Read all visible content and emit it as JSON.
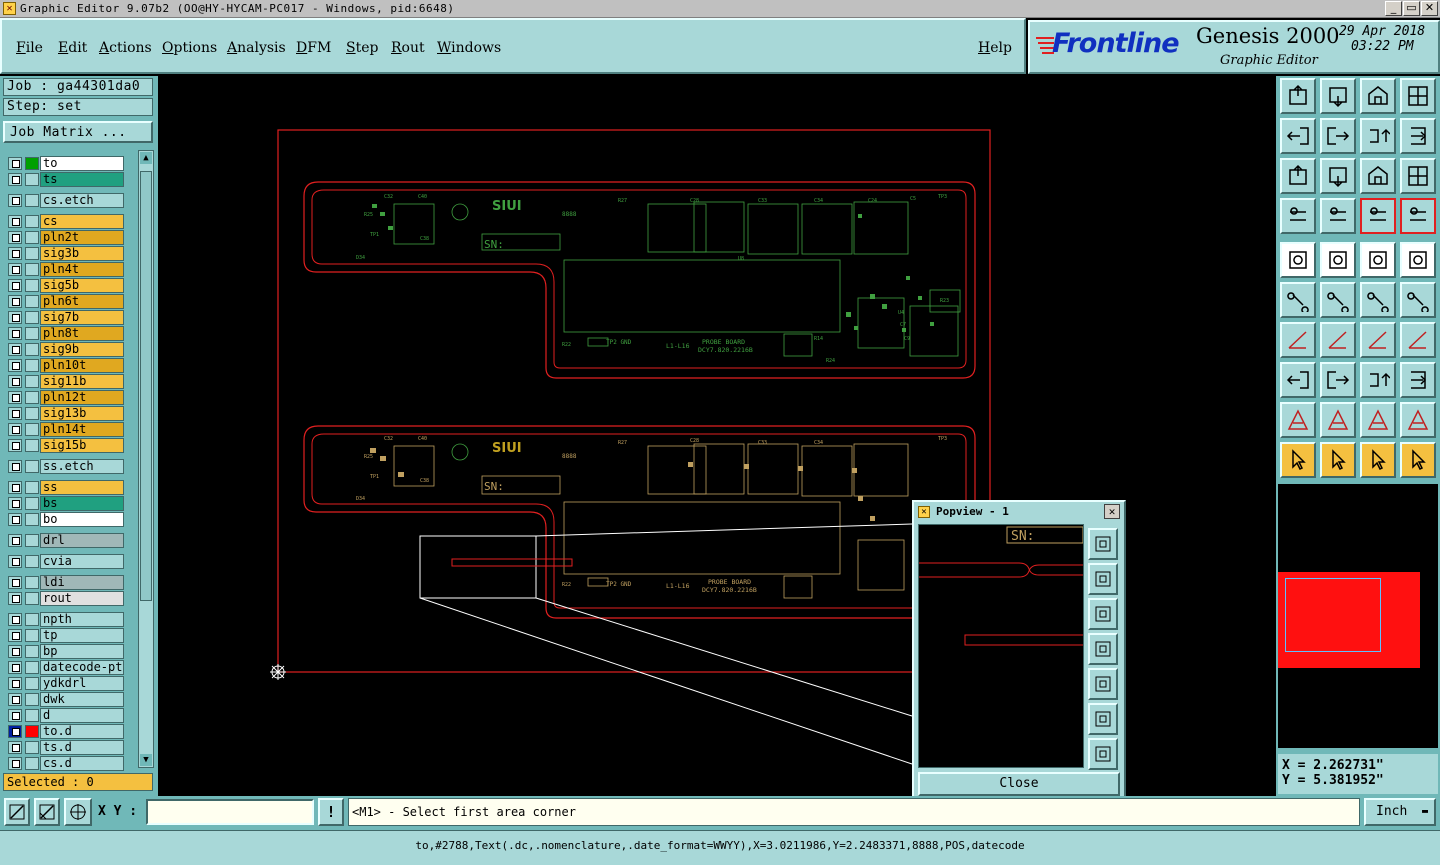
{
  "window": {
    "title": "Graphic Editor 9.07b2 (OO@HY-HYCAM-PC017 - Windows, pid:6648)",
    "buttons": [
      "_",
      "▭",
      "✕"
    ]
  },
  "menu": {
    "items": [
      "File",
      "Edit",
      "Actions",
      "Options",
      "Analysis",
      "DFM",
      "Step",
      "Rout",
      "Windows"
    ],
    "help": "Help"
  },
  "banner": {
    "brand": "Frontline",
    "product": "Genesis 2000",
    "subtitle": "Graphic Editor",
    "date": "29 Apr 2018",
    "time": "03:22 PM",
    "brand_color": "#1030c0",
    "accent_color": "#e02020"
  },
  "job": {
    "job_label": "Job : ga44301da0",
    "step_label": "Step: set",
    "matrix_button": "Job Matrix ..."
  },
  "layers": [
    {
      "name": "to",
      "color": "#00a000",
      "bg": "#ffffff"
    },
    {
      "name": "ts",
      "color": "",
      "bg": "#20a080"
    },
    {
      "name": "cs.etch",
      "color": "",
      "bg": "#a8d8d8"
    },
    {
      "name": "cs",
      "color": "",
      "bg": "#f4c040"
    },
    {
      "name": "pln2t",
      "color": "",
      "bg": "#e0a820"
    },
    {
      "name": "sig3b",
      "color": "",
      "bg": "#f4c040"
    },
    {
      "name": "pln4t",
      "color": "",
      "bg": "#e0a820"
    },
    {
      "name": "sig5b",
      "color": "",
      "bg": "#f4c040"
    },
    {
      "name": "pln6t",
      "color": "",
      "bg": "#e0a820"
    },
    {
      "name": "sig7b",
      "color": "",
      "bg": "#f4c040"
    },
    {
      "name": "pln8t",
      "color": "",
      "bg": "#e0a820"
    },
    {
      "name": "sig9b",
      "color": "",
      "bg": "#f4c040"
    },
    {
      "name": "pln10t",
      "color": "",
      "bg": "#e0a820"
    },
    {
      "name": "sig11b",
      "color": "",
      "bg": "#f4c040"
    },
    {
      "name": "pln12t",
      "color": "",
      "bg": "#e0a820"
    },
    {
      "name": "sig13b",
      "color": "",
      "bg": "#f4c040"
    },
    {
      "name": "pln14t",
      "color": "",
      "bg": "#e0a820"
    },
    {
      "name": "sig15b",
      "color": "",
      "bg": "#f4c040"
    },
    {
      "name": "ss.etch",
      "color": "",
      "bg": "#a8d8d8"
    },
    {
      "name": "ss",
      "color": "",
      "bg": "#f4c040"
    },
    {
      "name": "bs",
      "color": "",
      "bg": "#20a080"
    },
    {
      "name": "bo",
      "color": "",
      "bg": "#ffffff"
    },
    {
      "name": "drl",
      "color": "",
      "bg": "#a0b8b8"
    },
    {
      "name": "cvia",
      "color": "",
      "bg": "#a8d8d8"
    },
    {
      "name": "ldi",
      "color": "",
      "bg": "#a0b8b8"
    },
    {
      "name": "rout",
      "color": "",
      "bg": "#e0e0e0"
    },
    {
      "name": "npth",
      "color": "",
      "bg": "#a8d8d8"
    },
    {
      "name": "tp",
      "color": "",
      "bg": "#a8d8d8"
    },
    {
      "name": "bp",
      "color": "",
      "bg": "#a8d8d8"
    },
    {
      "name": "datecode-pt",
      "color": "",
      "bg": "#a8d8d8"
    },
    {
      "name": "ydkdrl",
      "color": "",
      "bg": "#a8d8d8"
    },
    {
      "name": "dwk",
      "color": "",
      "bg": "#a8d8d8"
    },
    {
      "name": "d",
      "color": "",
      "bg": "#a8d8d8"
    },
    {
      "name": "to.d",
      "color": "#ff0000",
      "bg": "#a8d8d8"
    },
    {
      "name": "ts.d",
      "color": "",
      "bg": "#a8d8d8"
    },
    {
      "name": "cs.d",
      "color": "",
      "bg": "#a8d8d8"
    }
  ],
  "selected": "Selected : 0",
  "command": {
    "xy_label": "X Y :",
    "xy_value": "",
    "prompt": "<M1> - Select first area corner",
    "units": "Inch"
  },
  "coords": {
    "x": "X = 2.262731\"",
    "y": "Y = 5.381952\""
  },
  "status": "to,#2788,Text(.dc,.nomenclature,.date_format=WWYY),X=3.0211986,Y=2.2483371,8888,POS,datecode",
  "popview": {
    "title": "Popview - 1",
    "close": "Close",
    "sn_text": "SN:"
  },
  "board": {
    "logo": "SIUI",
    "sn": "SN:",
    "code": "8888",
    "probe_text": "PROBE BOARD",
    "part_no": "DCY7.820.2216B",
    "layer_range": "L1-L16",
    "tp_label": "TP2 GND",
    "ref_labels": [
      "R27",
      "C28",
      "C33",
      "C34",
      "C24",
      "R22",
      "C4",
      "C40",
      "R25",
      "C38",
      "TP1",
      "C32",
      "D34",
      "R2",
      "U8",
      "C5",
      "TP3",
      "R23",
      "U4",
      "C7",
      "C9",
      "R14",
      "R24",
      "R9"
    ]
  }
}
